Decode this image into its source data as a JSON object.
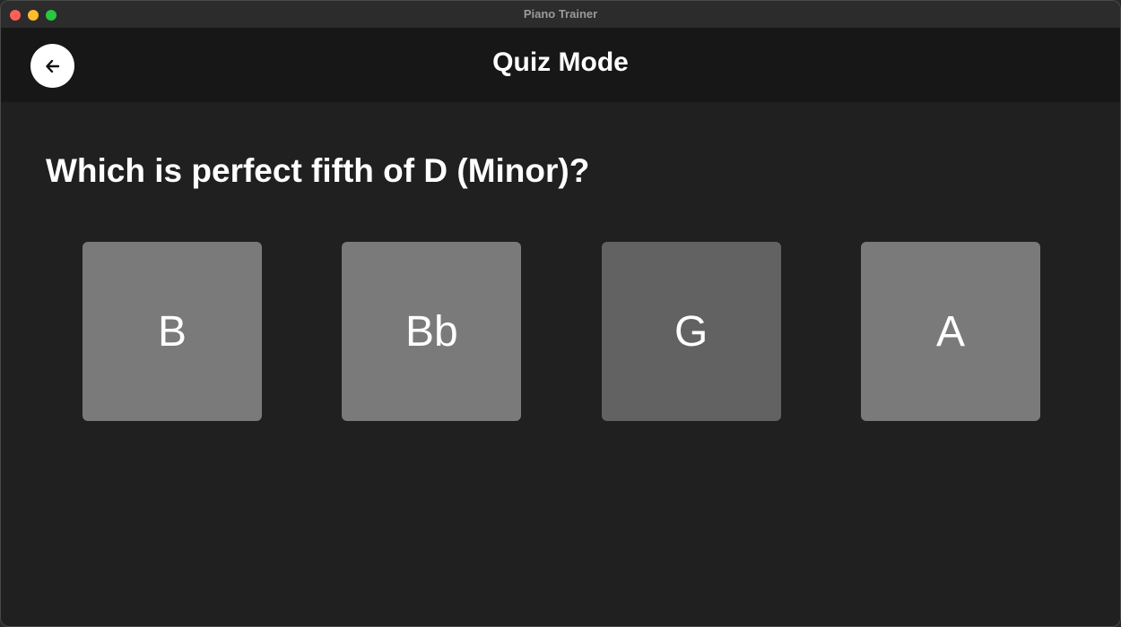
{
  "window": {
    "title": "Piano Trainer",
    "traffic_colors": {
      "close": "#fe5f57",
      "minimize": "#febc2e",
      "zoom": "#28c840"
    }
  },
  "header": {
    "title": "Quiz Mode",
    "back_icon": "arrow-left-icon"
  },
  "quiz": {
    "question": "Which is perfect fifth of D (Minor)?",
    "options": [
      {
        "label": "B",
        "color": "#7a7a7a"
      },
      {
        "label": "Bb",
        "color": "#7a7a7a"
      },
      {
        "label": "G",
        "color": "#626262"
      },
      {
        "label": "A",
        "color": "#7a7a7a"
      }
    ]
  }
}
